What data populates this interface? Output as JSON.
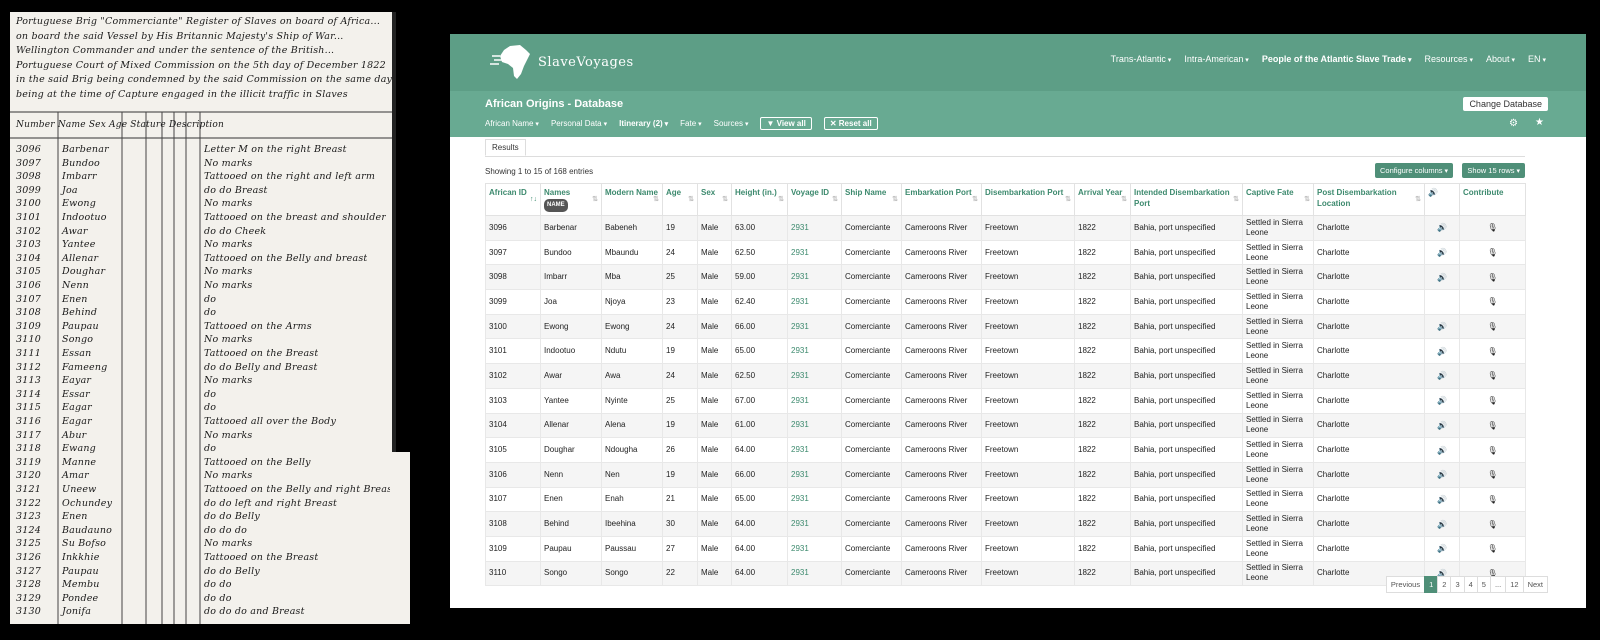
{
  "manuscript": {
    "lines": [
      "Portuguese Brig \"Commerciante\" Register of Slaves on board of Africa...",
      "on board the said Vessel by His Britannic Majesty's Ship of War...",
      "Wellington Commander and under the sentence of the British...",
      "Portuguese Court of Mixed Commission on the 5th day of December 1822",
      "in the said Brig being condemned by the said Commission on the same day",
      "being at the time of Capture engaged in the illicit traffic in Slaves",
      "Number   Name   Sex  Age  Stature   Description"
    ],
    "rows": [
      {
        "num": "3096",
        "name": "Barbenar",
        "desc": "Letter M on the right Breast"
      },
      {
        "num": "3097",
        "name": "Bundoo",
        "desc": "No marks"
      },
      {
        "num": "3098",
        "name": "Imbarr",
        "desc": "Tattooed on the right and left arm"
      },
      {
        "num": "3099",
        "name": "Joa",
        "desc": "do  do  Breast"
      },
      {
        "num": "3100",
        "name": "Ewong",
        "desc": "No marks"
      },
      {
        "num": "3101",
        "name": "Indootuo",
        "desc": "Tattooed on the breast and shoulder"
      },
      {
        "num": "3102",
        "name": "Awar",
        "desc": "do  do  Cheek"
      },
      {
        "num": "3103",
        "name": "Yantee",
        "desc": "No marks"
      },
      {
        "num": "3104",
        "name": "Allenar",
        "desc": "Tattooed on the Belly and breast"
      },
      {
        "num": "3105",
        "name": "Doughar",
        "desc": "No marks"
      },
      {
        "num": "3106",
        "name": "Nenn",
        "desc": "No marks"
      },
      {
        "num": "3107",
        "name": "Enen",
        "desc": "do"
      },
      {
        "num": "3108",
        "name": "Behind",
        "desc": "do"
      },
      {
        "num": "3109",
        "name": "Paupau",
        "desc": "Tattooed on the Arms"
      },
      {
        "num": "3110",
        "name": "Songo",
        "desc": "No marks"
      },
      {
        "num": "3111",
        "name": "Essan",
        "desc": "Tattooed on the Breast"
      },
      {
        "num": "3112",
        "name": "Fameeng",
        "desc": "do  do  Belly and Breast"
      },
      {
        "num": "3113",
        "name": "Eayar",
        "desc": "No marks"
      },
      {
        "num": "3114",
        "name": "Essar",
        "desc": "do"
      },
      {
        "num": "3115",
        "name": "Eagar",
        "desc": "do"
      },
      {
        "num": "3116",
        "name": "Eagar",
        "desc": "Tattooed all over the Body"
      },
      {
        "num": "3117",
        "name": "Abur",
        "desc": "No marks"
      },
      {
        "num": "3118",
        "name": "Ewang",
        "desc": "do"
      },
      {
        "num": "3119",
        "name": "Manne",
        "desc": "Tattooed on the Belly"
      },
      {
        "num": "3120",
        "name": "Amar",
        "desc": "No marks"
      },
      {
        "num": "3121",
        "name": "Uneew",
        "desc": "Tattooed on the Belly and right Breast"
      },
      {
        "num": "3122",
        "name": "Ochundey",
        "desc": "do  do  left and right Breast"
      },
      {
        "num": "3123",
        "name": "Enen",
        "desc": "do  do  Belly"
      },
      {
        "num": "3124",
        "name": "Baudauno",
        "desc": "do  do  do"
      },
      {
        "num": "3125",
        "name": "Su Bofso",
        "desc": "No marks"
      },
      {
        "num": "3126",
        "name": "Inkkhie",
        "desc": "Tattooed on the Breast"
      },
      {
        "num": "3127",
        "name": "Paupau",
        "desc": "do  do  Belly"
      },
      {
        "num": "3128",
        "name": "Membu",
        "desc": "do  do"
      },
      {
        "num": "3129",
        "name": "Pondee",
        "desc": "do  do"
      },
      {
        "num": "3130",
        "name": "Jonifa",
        "desc": "do  do  do  and Breast"
      }
    ]
  },
  "app": {
    "logo_text": "SlaveVoyages",
    "nav": [
      {
        "label": "Trans-Atlantic",
        "bold": false
      },
      {
        "label": "Intra-American",
        "bold": false
      },
      {
        "label": "People of the Atlantic Slave Trade",
        "bold": true
      },
      {
        "label": "Resources",
        "bold": false
      },
      {
        "label": "About",
        "bold": false
      },
      {
        "label": "EN",
        "bold": false
      }
    ],
    "db_title": "African Origins - Database",
    "change_db": "Change Database",
    "filters": [
      "African Name",
      "Personal Data",
      "Itinerary (2)",
      "Fate",
      "Sources"
    ],
    "view_all": "View all",
    "reset_all": "Reset all",
    "tab_results": "Results",
    "showing": "Showing 1 to 15 of 168 entries",
    "configure_columns": "Configure columns",
    "show_rows": "Show 15 rows",
    "name_badge": "NAME",
    "columns": [
      "African ID",
      "Names",
      "Modern Name",
      "Age",
      "Sex",
      "Height (in.)",
      "Voyage ID",
      "Ship Name",
      "Embarkation Port",
      "Disembarkation Port",
      "Arrival Year",
      "Intended Disembarkation Port",
      "Captive Fate",
      "Post Disembarkation Location",
      "",
      "Contribute"
    ],
    "rows": [
      {
        "id": "3096",
        "name": "Barbenar",
        "modern": "Babeneh",
        "age": "19",
        "sex": "Male",
        "height": "63.00",
        "voyage": "2931",
        "ship": "Comerciante",
        "emb": "Cameroons River",
        "dis": "Freetown",
        "year": "1822",
        "intended": "Bahia, port unspecified",
        "fate": "Settled in Sierra Leone",
        "post": "Charlotte",
        "audio": true
      },
      {
        "id": "3097",
        "name": "Bundoo",
        "modern": "Mbaundu",
        "age": "24",
        "sex": "Male",
        "height": "62.50",
        "voyage": "2931",
        "ship": "Comerciante",
        "emb": "Cameroons River",
        "dis": "Freetown",
        "year": "1822",
        "intended": "Bahia, port unspecified",
        "fate": "Settled in Sierra Leone",
        "post": "Charlotte",
        "audio": true
      },
      {
        "id": "3098",
        "name": "Imbarr",
        "modern": "Mba",
        "age": "25",
        "sex": "Male",
        "height": "59.00",
        "voyage": "2931",
        "ship": "Comerciante",
        "emb": "Cameroons River",
        "dis": "Freetown",
        "year": "1822",
        "intended": "Bahia, port unspecified",
        "fate": "Settled in Sierra Leone",
        "post": "Charlotte",
        "audio": true
      },
      {
        "id": "3099",
        "name": "Joa",
        "modern": "Njoya",
        "age": "23",
        "sex": "Male",
        "height": "62.40",
        "voyage": "2931",
        "ship": "Comerciante",
        "emb": "Cameroons River",
        "dis": "Freetown",
        "year": "1822",
        "intended": "Bahia, port unspecified",
        "fate": "Settled in Sierra Leone",
        "post": "Charlotte",
        "audio": false
      },
      {
        "id": "3100",
        "name": "Ewong",
        "modern": "Ewong",
        "age": "24",
        "sex": "Male",
        "height": "66.00",
        "voyage": "2931",
        "ship": "Comerciante",
        "emb": "Cameroons River",
        "dis": "Freetown",
        "year": "1822",
        "intended": "Bahia, port unspecified",
        "fate": "Settled in Sierra Leone",
        "post": "Charlotte",
        "audio": true
      },
      {
        "id": "3101",
        "name": "Indootuo",
        "modern": "Ndutu",
        "age": "19",
        "sex": "Male",
        "height": "65.00",
        "voyage": "2931",
        "ship": "Comerciante",
        "emb": "Cameroons River",
        "dis": "Freetown",
        "year": "1822",
        "intended": "Bahia, port unspecified",
        "fate": "Settled in Sierra Leone",
        "post": "Charlotte",
        "audio": true
      },
      {
        "id": "3102",
        "name": "Awar",
        "modern": "Awa",
        "age": "24",
        "sex": "Male",
        "height": "62.50",
        "voyage": "2931",
        "ship": "Comerciante",
        "emb": "Cameroons River",
        "dis": "Freetown",
        "year": "1822",
        "intended": "Bahia, port unspecified",
        "fate": "Settled in Sierra Leone",
        "post": "Charlotte",
        "audio": true
      },
      {
        "id": "3103",
        "name": "Yantee",
        "modern": "Nyinte",
        "age": "25",
        "sex": "Male",
        "height": "67.00",
        "voyage": "2931",
        "ship": "Comerciante",
        "emb": "Cameroons River",
        "dis": "Freetown",
        "year": "1822",
        "intended": "Bahia, port unspecified",
        "fate": "Settled in Sierra Leone",
        "post": "Charlotte",
        "audio": true
      },
      {
        "id": "3104",
        "name": "Allenar",
        "modern": "Alena",
        "age": "19",
        "sex": "Male",
        "height": "61.00",
        "voyage": "2931",
        "ship": "Comerciante",
        "emb": "Cameroons River",
        "dis": "Freetown",
        "year": "1822",
        "intended": "Bahia, port unspecified",
        "fate": "Settled in Sierra Leone",
        "post": "Charlotte",
        "audio": true
      },
      {
        "id": "3105",
        "name": "Doughar",
        "modern": "Ndougha",
        "age": "26",
        "sex": "Male",
        "height": "64.00",
        "voyage": "2931",
        "ship": "Comerciante",
        "emb": "Cameroons River",
        "dis": "Freetown",
        "year": "1822",
        "intended": "Bahia, port unspecified",
        "fate": "Settled in Sierra Leone",
        "post": "Charlotte",
        "audio": true
      },
      {
        "id": "3106",
        "name": "Nenn",
        "modern": "Nen",
        "age": "19",
        "sex": "Male",
        "height": "66.00",
        "voyage": "2931",
        "ship": "Comerciante",
        "emb": "Cameroons River",
        "dis": "Freetown",
        "year": "1822",
        "intended": "Bahia, port unspecified",
        "fate": "Settled in Sierra Leone",
        "post": "Charlotte",
        "audio": true
      },
      {
        "id": "3107",
        "name": "Enen",
        "modern": "Enah",
        "age": "21",
        "sex": "Male",
        "height": "65.00",
        "voyage": "2931",
        "ship": "Comerciante",
        "emb": "Cameroons River",
        "dis": "Freetown",
        "year": "1822",
        "intended": "Bahia, port unspecified",
        "fate": "Settled in Sierra Leone",
        "post": "Charlotte",
        "audio": true
      },
      {
        "id": "3108",
        "name": "Behind",
        "modern": "Ibeehina",
        "age": "30",
        "sex": "Male",
        "height": "64.00",
        "voyage": "2931",
        "ship": "Comerciante",
        "emb": "Cameroons River",
        "dis": "Freetown",
        "year": "1822",
        "intended": "Bahia, port unspecified",
        "fate": "Settled in Sierra Leone",
        "post": "Charlotte",
        "audio": true
      },
      {
        "id": "3109",
        "name": "Paupau",
        "modern": "Paussau",
        "age": "27",
        "sex": "Male",
        "height": "64.00",
        "voyage": "2931",
        "ship": "Comerciante",
        "emb": "Cameroons River",
        "dis": "Freetown",
        "year": "1822",
        "intended": "Bahia, port unspecified",
        "fate": "Settled in Sierra Leone",
        "post": "Charlotte",
        "audio": true
      },
      {
        "id": "3110",
        "name": "Songo",
        "modern": "Songo",
        "age": "22",
        "sex": "Male",
        "height": "64.00",
        "voyage": "2931",
        "ship": "Comerciante",
        "emb": "Cameroons River",
        "dis": "Freetown",
        "year": "1822",
        "intended": "Bahia, port unspecified",
        "fate": "Settled in Sierra Leone",
        "post": "Charlotte",
        "audio": true
      }
    ],
    "pagination": [
      "Previous",
      "1",
      "2",
      "3",
      "4",
      "5",
      "...",
      "12",
      "Next"
    ],
    "active_page": "1",
    "colors": {
      "nav": "#5d9e86",
      "subbar": "#68aa92",
      "accent": "#3d8a6e"
    }
  }
}
